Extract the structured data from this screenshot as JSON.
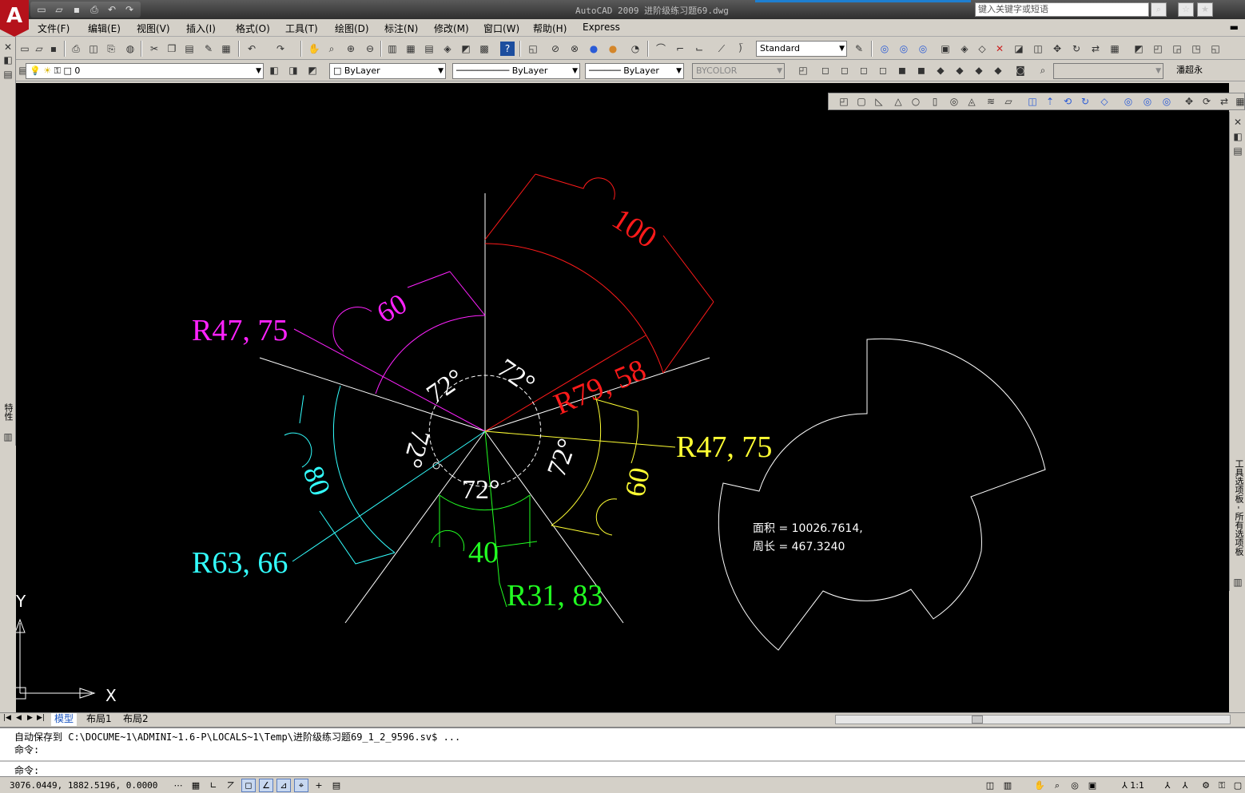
{
  "app": {
    "logo": "A",
    "title": "AutoCAD 2009 进阶级练习题69.dwg",
    "search_placeholder": "键入关键字或短语"
  },
  "menu": [
    "文件(F)",
    "编辑(E)",
    "视图(V)",
    "插入(I)",
    "格式(O)",
    "工具(T)",
    "绘图(D)",
    "标注(N)",
    "修改(M)",
    "窗口(W)",
    "帮助(H)",
    "Express"
  ],
  "toolbar": {
    "text_style": "Standard",
    "layer": "0",
    "color": "ByLayer",
    "linetype": "ByLayer",
    "lineweight": "ByLayer",
    "plotstyle": "BYCOLOR",
    "user": "潘超永"
  },
  "palettes": {
    "properties_label": "特性",
    "tool_palettes_label": "工具选项板 - 所有选项板"
  },
  "drawing": {
    "dim_red_arc": "100",
    "dim_red_radius": "R79, 58",
    "dim_magenta_arc": "60",
    "dim_magenta_radius": "R47, 75",
    "dim_yellow_arc": "60",
    "dim_yellow_radius": "R47, 75",
    "dim_cyan_arc": "80",
    "dim_cyan_radius": "R63, 66",
    "dim_green_chord": "40",
    "dim_green_radius": "R31, 83",
    "angle_top_left": "72°",
    "angle_top_right": "72°",
    "angle_left": "72°",
    "angle_right": "72°",
    "angle_bottom": "72°",
    "area_label": "面积 = 10026.7614,",
    "perimeter_label": "周长 = 467.3240",
    "ucs_x": "X",
    "ucs_y": "Y"
  },
  "tabs": [
    "模型",
    "布局1",
    "布局2"
  ],
  "command": {
    "line1": "自动保存到 C:\\DOCUME~1\\ADMINI~1.6-P\\LOCALS~1\\Temp\\进阶级练习题69_1_2_9596.sv$ ...",
    "line2": "命令:",
    "prompt": "命令:"
  },
  "status": {
    "coords": "3076.0449, 1882.5196, 0.0000",
    "scale": "1:1"
  },
  "colors": {
    "canvas_bg": "#000000",
    "red": "#ff1a1a",
    "magenta": "#ff22ff",
    "yellow": "#ffff33",
    "cyan": "#33ffff",
    "green": "#22ff22",
    "white": "#ffffff"
  }
}
